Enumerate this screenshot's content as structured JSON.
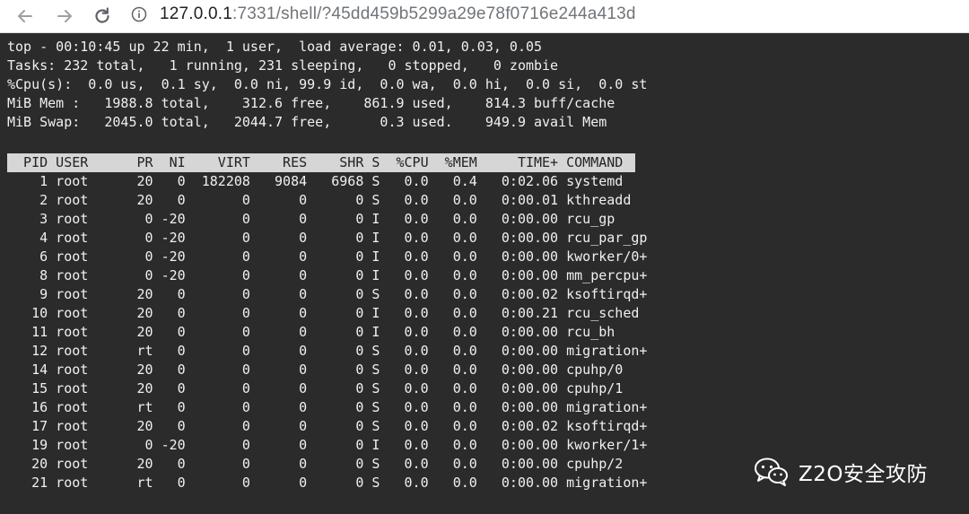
{
  "browser": {
    "url_host": "127.0.0.1",
    "url_rest": ":7331/shell/?45dd459b5299a29e78f0716e244a413d",
    "icons": [
      "back-arrow-icon",
      "forward-arrow-icon",
      "reload-icon",
      "info-icon"
    ]
  },
  "terminal": {
    "summary": [
      "top - 00:10:45 up 22 min,  1 user,  load average: 0.01, 0.03, 0.05",
      "Tasks: 232 total,   1 running, 231 sleeping,   0 stopped,   0 zombie",
      "%Cpu(s):  0.0 us,  0.1 sy,  0.0 ni, 99.9 id,  0.0 wa,  0.0 hi,  0.0 si,  0.0 st",
      "MiB Mem :   1988.8 total,    312.6 free,    861.9 used,    814.3 buff/cache",
      "MiB Swap:   2045.0 total,   2044.7 free,      0.3 used.    949.9 avail Mem"
    ],
    "columns_header": "  PID USER      PR  NI    VIRT    RES    SHR S  %CPU  %MEM     TIME+ COMMAND",
    "processes": [
      "    1 root      20   0  182208   9084   6968 S   0.0   0.4   0:02.06 systemd",
      "    2 root      20   0       0      0      0 S   0.0   0.0   0:00.01 kthreadd",
      "    3 root       0 -20       0      0      0 I   0.0   0.0   0:00.00 rcu_gp",
      "    4 root       0 -20       0      0      0 I   0.0   0.0   0:00.00 rcu_par_gp",
      "    6 root       0 -20       0      0      0 I   0.0   0.0   0:00.00 kworker/0+",
      "    8 root       0 -20       0      0      0 I   0.0   0.0   0:00.00 mm_percpu+",
      "    9 root      20   0       0      0      0 S   0.0   0.0   0:00.02 ksoftirqd+",
      "   10 root      20   0       0      0      0 I   0.0   0.0   0:00.21 rcu_sched",
      "   11 root      20   0       0      0      0 I   0.0   0.0   0:00.00 rcu_bh",
      "   12 root      rt   0       0      0      0 S   0.0   0.0   0:00.00 migration+",
      "   14 root      20   0       0      0      0 S   0.0   0.0   0:00.00 cpuhp/0",
      "   15 root      20   0       0      0      0 S   0.0   0.0   0:00.00 cpuhp/1",
      "   16 root      rt   0       0      0      0 S   0.0   0.0   0:00.00 migration+",
      "   17 root      20   0       0      0      0 S   0.0   0.0   0:00.02 ksoftirqd+",
      "   19 root       0 -20       0      0      0 I   0.0   0.0   0:00.00 kworker/1+",
      "   20 root      20   0       0      0      0 S   0.0   0.0   0:00.00 cpuhp/2",
      "   21 root      rt   0       0      0      0 S   0.0   0.0   0:00.00 migration+"
    ]
  },
  "watermark": {
    "text": "Z2O安全攻防",
    "icon": "wechat-icon"
  },
  "colors": {
    "terminal_bg": "#2b2b2b",
    "terminal_fg": "#f0f0f0",
    "header_bg": "#d6d6d6",
    "browser_bar_bg": "#ffffff",
    "url_host": "#202124",
    "url_path": "#70757a"
  }
}
